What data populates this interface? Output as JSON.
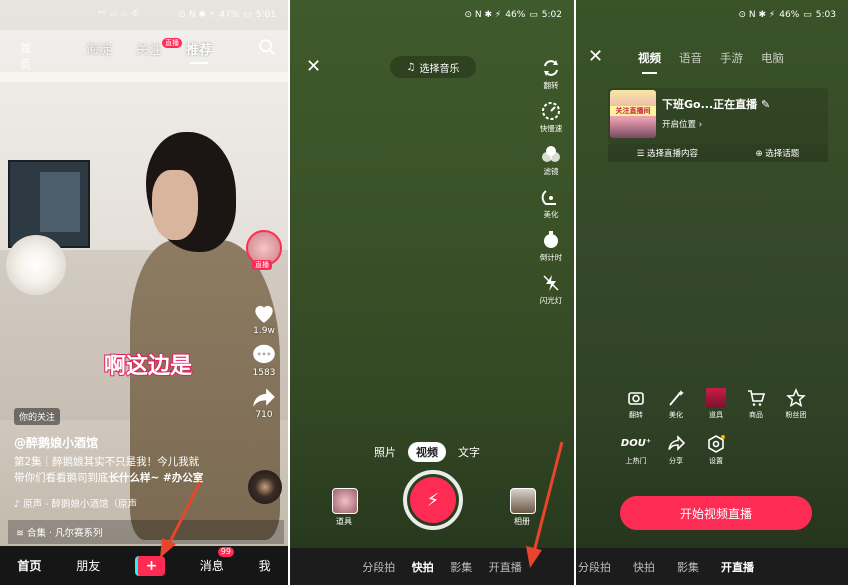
{
  "panel1": {
    "status": {
      "signal": "⁴ᴳ ᵢₗₗ ᵢₗₗ ✆",
      "icons": "⊙ N ✱ ⚡",
      "battery": "47%",
      "time": "5:01"
    },
    "top_tabs": [
      {
        "label": "海淀"
      },
      {
        "label": "关注",
        "badge": "直播"
      },
      {
        "label": "推荐",
        "active": true
      }
    ],
    "menu_icon_text": "首页",
    "side": {
      "likes": "1.9w",
      "comments": "1583",
      "shares": "710",
      "live_badge": "直播"
    },
    "caption_overlay": "啊这边是",
    "follow_tag": "你的关注",
    "author": "@醉鹅娘小酒馆",
    "desc_line1": "第2集｜醉鹅娘其实不只是我！今儿我就",
    "desc_line2_a": "带你们看看鹅司到底",
    "desc_line2_b": "长什么样~ #办公室",
    "music": "♪ 原声 - 醉鹅娘小酒馆（原声",
    "collection": "≋ 合集 · 凡尔赛系列",
    "nav": {
      "home": "首页",
      "friends": "朋友",
      "plus": "+",
      "messages": "消息",
      "messages_badge": "99",
      "me": "我"
    }
  },
  "panel2": {
    "status": {
      "icons": "⊙ N ✱ ⚡",
      "battery": "46%",
      "time": "5:02"
    },
    "close": "✕",
    "music_pill": "选择音乐",
    "tools": [
      {
        "name": "flip-icon",
        "label": "翻转"
      },
      {
        "name": "speed-icon",
        "label": "快慢速"
      },
      {
        "name": "filter-icon",
        "label": "滤镜"
      },
      {
        "name": "beauty-icon",
        "label": "美化"
      },
      {
        "name": "timer-icon",
        "label": "倒计时"
      },
      {
        "name": "flash-icon",
        "label": "闪光灯"
      }
    ],
    "modes": [
      "照片",
      "视频",
      "文字"
    ],
    "active_mode": "视频",
    "props_label": "道具",
    "album_label": "相册",
    "nav": [
      "分段拍",
      "快拍",
      "影集",
      "开直播"
    ],
    "nav_active": "快拍"
  },
  "panel3": {
    "status": {
      "icons": "⊙ N ✱ ⚡",
      "battery": "46%",
      "time": "5:03"
    },
    "close": "✕",
    "tabs": [
      "视频",
      "语音",
      "手游",
      "电脑"
    ],
    "active_tab": "视频",
    "cover_text": "关注直播间",
    "live_title": "下班Go...正在直播 ✎",
    "live_location": "开启位置 ›",
    "opt_content": "☰ 选择直播内容",
    "opt_topic": "⊕ 选择话题",
    "grid": [
      {
        "name": "flip-camera-icon",
        "label": "翻转"
      },
      {
        "name": "beauty-wand-icon",
        "label": "美化"
      },
      {
        "name": "props-icon",
        "label": "道具"
      },
      {
        "name": "shop-icon",
        "label": "商品"
      },
      {
        "name": "fan-club-icon",
        "label": "粉丝团"
      },
      {
        "name": "douo-icon",
        "label": "上热门"
      },
      {
        "name": "share-icon",
        "label": "分享"
      },
      {
        "name": "settings-icon",
        "label": "设置"
      }
    ],
    "douo_text": "DOU⁺",
    "start_button": "开始视频直播",
    "nav": [
      "分段拍",
      "快拍",
      "影集",
      "开直播"
    ],
    "nav_active": "开直播"
  },
  "colors": {
    "accent": "#fe2c55",
    "arrow": "#e8452c",
    "cyan": "#25f4ee"
  }
}
